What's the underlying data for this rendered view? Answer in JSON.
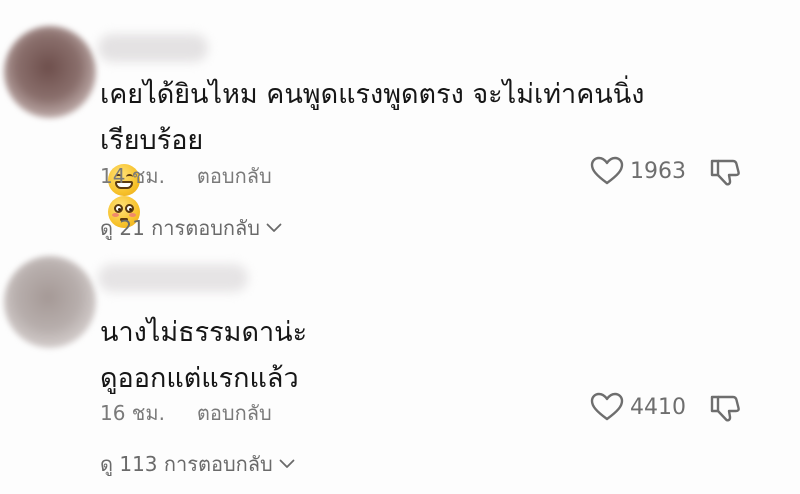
{
  "comments": [
    {
      "text_line1": "เคยได้ยินไหม คนพูดแรงพูดตรง จะไม่เท่าคนนิ่ง",
      "text_line2": "เรียบร้อย",
      "emojis": [
        "grinning-face-with-smiling-eyes",
        "flushed-face"
      ],
      "time": "14 ชม.",
      "reply_label": "ตอบกลับ",
      "likes": "1963",
      "view_replies": "ดู 21 การตอบกลับ",
      "avatar_color": "#8a6f6c"
    },
    {
      "text_line1": "นางไม่ธรรมดาน่ะ",
      "text_line2": "ดูออกแต่แรกแล้ว",
      "emojis": [],
      "time": "16 ชม.",
      "reply_label": "ตอบกลับ",
      "likes": "4410",
      "view_replies": "ดู 113 การตอบกลับ",
      "avatar_color": "#b7aeac"
    }
  ],
  "icons": {
    "like": "heart-outline-icon",
    "dislike": "thumbs-down-outline-icon",
    "expand": "chevron-down-icon"
  },
  "colors": {
    "text": "#161616",
    "meta": "#7a7a7a",
    "icon": "#6e6e6e"
  }
}
